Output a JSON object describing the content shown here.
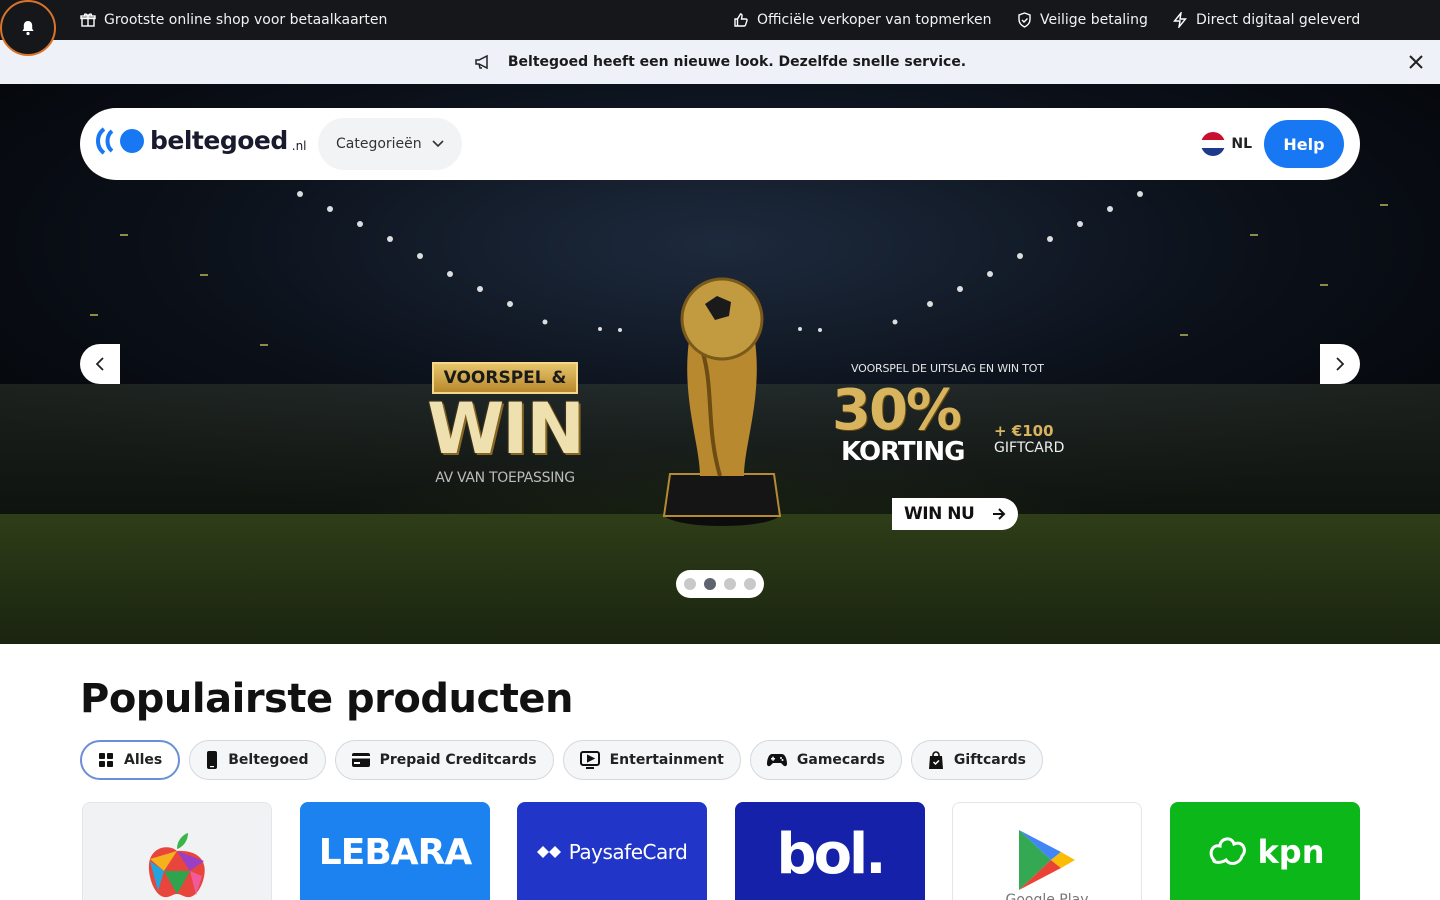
{
  "topbar": {
    "left_text": "Grootste online shop voor betaalkaarten",
    "item1": "Officiële verkoper van topmerken",
    "item2": "Veilige betaling",
    "item3": "Direct digitaal geleverd"
  },
  "announcement": {
    "text": "Beltegoed heeft een nieuwe look. Dezelfde snelle service."
  },
  "navbar": {
    "logo_text": "beltegoed",
    "logo_tld": ".nl",
    "categories_label": "Categorieën",
    "language": "NL",
    "help_label": "Help"
  },
  "hero": {
    "tag": "VOORSPEL &",
    "headline": "WIN",
    "subline": "AV VAN TOEPASSING",
    "promo_sub": "VOORSPEL DE UITSLAG EN WIN TOT",
    "promo_pct": "30%",
    "promo_korting": "KORTING",
    "promo_bonus_amount": "+ €100",
    "promo_bonus_label": "GIFTCARD",
    "cta": "WIN NU",
    "slide_count": 4,
    "active_slide": 2
  },
  "section": {
    "title": "Populairste producten",
    "filters": [
      {
        "label": "Alles",
        "icon": "grid-icon",
        "active": true
      },
      {
        "label": "Beltegoed",
        "icon": "phone-icon",
        "active": false
      },
      {
        "label": "Prepaid Creditcards",
        "icon": "credit-card-icon",
        "active": false
      },
      {
        "label": "Entertainment",
        "icon": "play-screen-icon",
        "active": false
      },
      {
        "label": "Gamecards",
        "icon": "gamepad-icon",
        "active": false
      },
      {
        "label": "Giftcards",
        "icon": "shopping-bag-icon",
        "active": false
      }
    ]
  },
  "products": [
    {
      "name": "apple",
      "label": "",
      "bg": "#f1f2f4"
    },
    {
      "name": "lebara",
      "label": "LEBARA",
      "bg": "#1b82ef"
    },
    {
      "name": "paysafecard",
      "label": "PaysafeCard",
      "bg": "#2136c8"
    },
    {
      "name": "bol",
      "label": "bol.",
      "bg": "#1421a8"
    },
    {
      "name": "google-play",
      "label": "Google Play",
      "bg": "#ffffff"
    },
    {
      "name": "kpn",
      "label": "kpn",
      "bg": "#0cb71a"
    }
  ],
  "colors": {
    "topbar_bg": "#16171b",
    "announce_bg": "#eef1f7",
    "accent_blue": "#1877f2",
    "chip_active_border": "#6b8fd6",
    "gold": "#d8b45e"
  }
}
